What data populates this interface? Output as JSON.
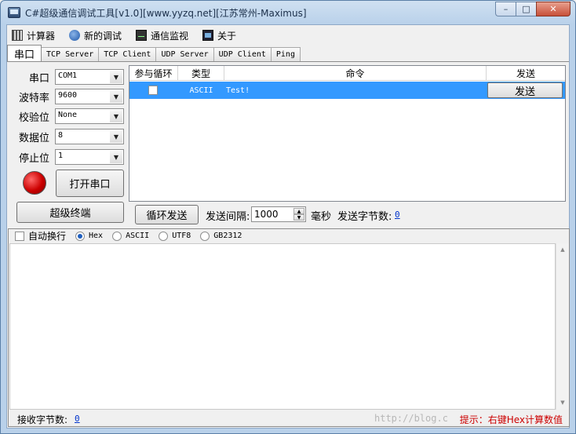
{
  "window": {
    "title": "C#超级通信调试工具[v1.0][www.yyzq.net][江苏常州-Maximus]",
    "min": "–",
    "max": "□",
    "close": "✕"
  },
  "toolbar": {
    "items": [
      {
        "label": "计算器",
        "icon": "calculator-icon"
      },
      {
        "label": "新的调试",
        "icon": "new-debug-icon"
      },
      {
        "label": "通信监视",
        "icon": "monitor-icon"
      },
      {
        "label": "关于",
        "icon": "about-icon"
      }
    ]
  },
  "tabs": [
    "串口",
    "TCP Server",
    "TCP Client",
    "UDP Server",
    "UDP Client",
    "Ping"
  ],
  "serial": {
    "port_label": "串口",
    "port_value": "COM1",
    "baud_label": "波特率",
    "baud_value": "9600",
    "parity_label": "校验位",
    "parity_value": "None",
    "databits_label": "数据位",
    "databits_value": "8",
    "stopbits_label": "停止位",
    "stopbits_value": "1",
    "open_button": "打开串口",
    "terminal_button": "超级终端"
  },
  "cmd_table": {
    "headers": [
      "参与循环",
      "类型",
      "命令",
      "发送"
    ],
    "rows": [
      {
        "type": "ASCII",
        "command": "Test!",
        "send": "发送"
      }
    ]
  },
  "loop": {
    "button": "循环发送",
    "interval_label": "发送间隔:",
    "interval_value": "1000",
    "unit": "毫秒",
    "sent_label": "发送字节数:",
    "sent_value": "0"
  },
  "recv": {
    "autowrap": "自动换行",
    "encodings": [
      "Hex",
      "ASCII",
      "UTF8",
      "GB2312"
    ],
    "received_label": "接收字节数:",
    "received_value": "0",
    "watermark": "http://blog.c",
    "hint": "提示：右键Hex计算数值"
  },
  "colors": {
    "selection": "#3399ff",
    "hint": "#cc0000",
    "status_light": "#cc0000"
  }
}
